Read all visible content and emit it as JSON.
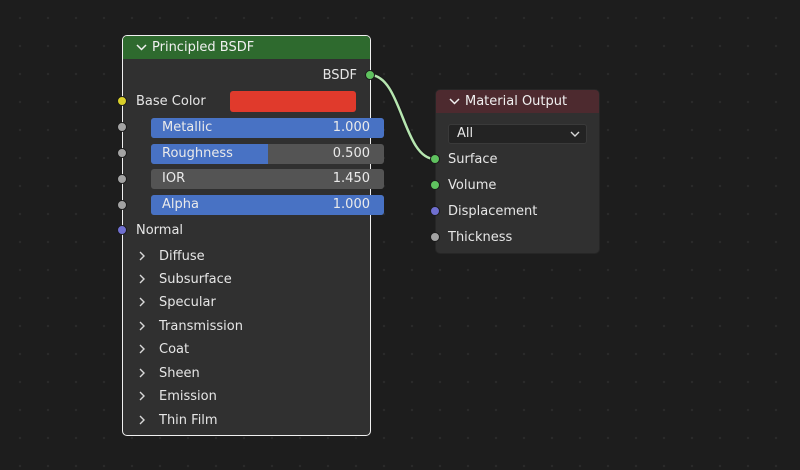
{
  "colors": {
    "bsdf_header": "#2e6a2e",
    "output_header": "#4d2a2f",
    "base_color": "#e03a2c",
    "slider_fill": "#4872c4",
    "link": "#b6e6b0"
  },
  "principled": {
    "title": "Principled BSDF",
    "output_socket": "BSDF",
    "base_color_label": "Base Color",
    "metallic": {
      "label": "Metallic",
      "value": "1.000",
      "fill": 1.0
    },
    "roughness": {
      "label": "Roughness",
      "value": "0.500",
      "fill": 0.5
    },
    "ior": {
      "label": "IOR",
      "value": "1.450"
    },
    "alpha": {
      "label": "Alpha",
      "value": "1.000",
      "fill": 1.0
    },
    "normal_label": "Normal",
    "panels": [
      "Diffuse",
      "Subsurface",
      "Specular",
      "Transmission",
      "Coat",
      "Sheen",
      "Emission",
      "Thin Film"
    ]
  },
  "material_output": {
    "title": "Material Output",
    "target": "All",
    "inputs": [
      "Surface",
      "Volume",
      "Displacement",
      "Thickness"
    ]
  }
}
